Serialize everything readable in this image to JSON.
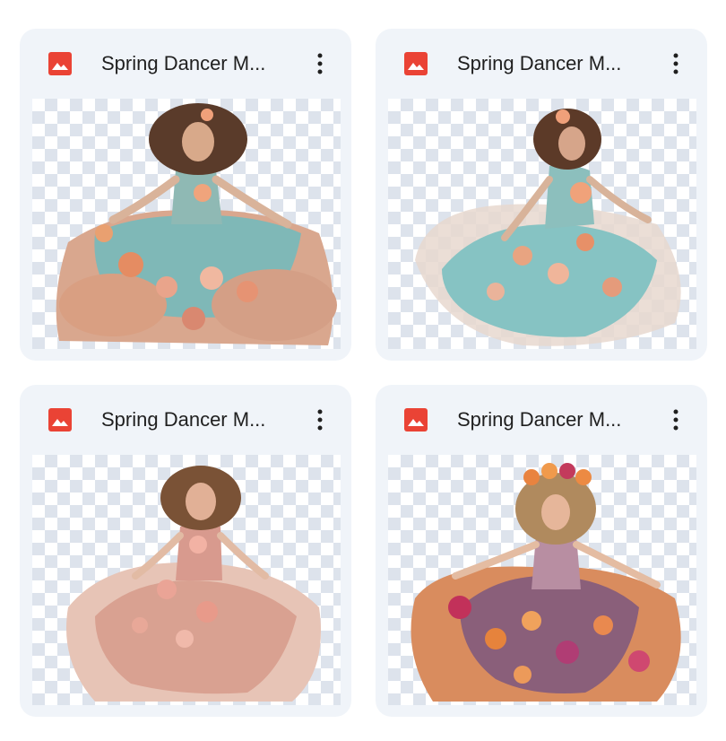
{
  "files": [
    {
      "name": "Spring Dancer M...",
      "icon": "image-file-icon",
      "menu_icon": "more-vert-icon",
      "thumbnail": "girl-teal-peach-flower-dress"
    },
    {
      "name": "Spring Dancer M...",
      "icon": "image-file-icon",
      "menu_icon": "more-vert-icon",
      "thumbnail": "girl-teal-flower-dress-spinning"
    },
    {
      "name": "Spring Dancer M...",
      "icon": "image-file-icon",
      "menu_icon": "more-vert-icon",
      "thumbnail": "girl-pink-flower-dress"
    },
    {
      "name": "Spring Dancer M...",
      "icon": "image-file-icon",
      "menu_icon": "more-vert-icon",
      "thumbnail": "girl-colorful-flower-crown-dress"
    }
  ],
  "colors": {
    "card_bg": "#f0f4f9",
    "icon_red": "#ea4335",
    "text": "#1f1f1f",
    "checker": "#dde3ec"
  }
}
